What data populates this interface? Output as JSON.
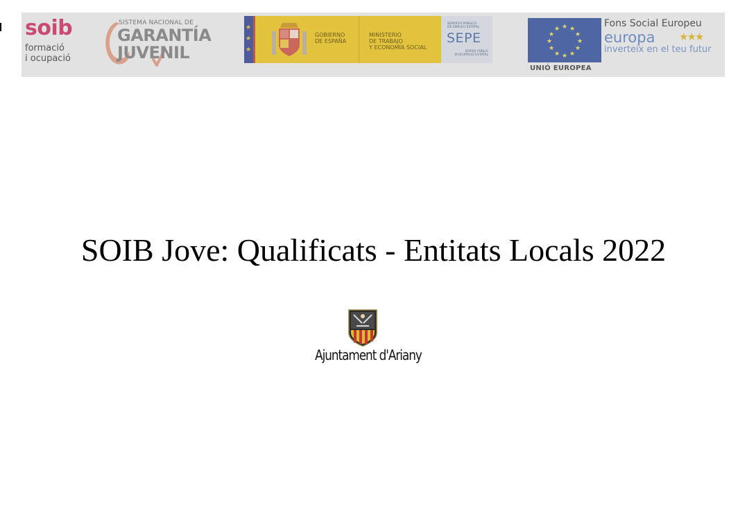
{
  "banner": {
    "soib": {
      "name": "soib",
      "line1": "formació",
      "line2": "i ocupació",
      "color": "#c94a73"
    },
    "garantia": {
      "top": "SISTEMA NACIONAL DE",
      "mid": "GARANTÍA",
      "bottom": "JUVENIL"
    },
    "gobierno": {
      "line1": "GOBIERNO",
      "line2": "DE ESPAÑA"
    },
    "ministerio": {
      "line1": "MINISTERIO",
      "line2": "DE TRABAJO",
      "line3": "Y ECONOMÍA SOCIAL"
    },
    "sepe": {
      "top1": "SERVICIO PÚBLICO",
      "top2": "DE EMPLEO ESTATAL",
      "name": "SEPE",
      "bottom1": "SERVEI PÚBLIC",
      "bottom2": "D'OCUPACIÓ ESTATAL"
    },
    "eu": {
      "label": "UNIÓ EUROPEA"
    },
    "fse": {
      "title": "Fons Social Europeu",
      "europa": "europa",
      "tagline": "inverteix en el teu futur"
    }
  },
  "main": {
    "title": "SOIB Jove: Qualificats - Entitats Locals 2022"
  },
  "footer_logo": {
    "name": "Ajuntament d'Ariany",
    "icon": "municipal-crest-icon"
  }
}
